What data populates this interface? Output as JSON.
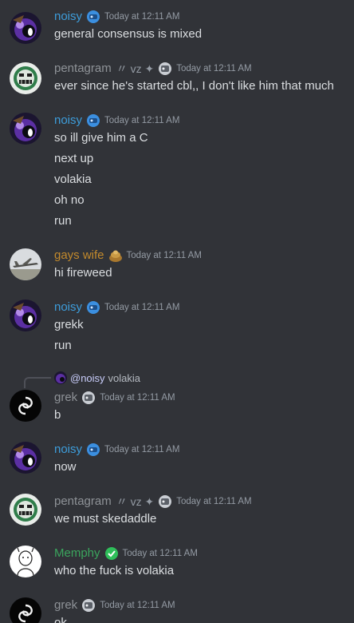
{
  "colors": {
    "background": "#313338",
    "noisy": "#3d9ddb",
    "pentagram": "#8e9297",
    "gays_wife": "#c38a2c",
    "grek": "#8e9297",
    "memphy": "#3ba55d",
    "message_text": "#dbdee1",
    "timestamp": "#949ba4"
  },
  "messages": [
    {
      "author": "noisy",
      "tag": "",
      "role_icon": "blue-emblem-icon",
      "timestamp": "Today at 12:11 AM",
      "lines": [
        "general consensus is mixed"
      ]
    },
    {
      "author": "pentagram",
      "tag": "〃 vz ✦",
      "role_icon": "grey-emblem-icon",
      "timestamp": "Today at 12:11 AM",
      "lines": [
        "ever since he's started cbl,, I don't like him that much"
      ]
    },
    {
      "author": "noisy",
      "tag": "",
      "role_icon": "blue-emblem-icon",
      "timestamp": "Today at 12:11 AM",
      "lines": [
        "so ill give him a C",
        "next up",
        "volakia",
        "oh no",
        "run"
      ]
    },
    {
      "author": "gays wife",
      "tag": "",
      "role_icon": "gold-emblem-icon",
      "timestamp": "Today at 12:11 AM",
      "lines": [
        "hi fireweed"
      ]
    },
    {
      "author": "noisy",
      "tag": "",
      "role_icon": "blue-emblem-icon",
      "timestamp": "Today at 12:11 AM",
      "lines": [
        "grekk",
        "run"
      ]
    },
    {
      "reply": {
        "mention": "@noisy",
        "text": "volakia"
      },
      "author": "grek",
      "tag": "",
      "role_icon": "grey-emblem-icon",
      "timestamp": "Today at 12:11 AM",
      "lines": [
        "b"
      ]
    },
    {
      "author": "noisy",
      "tag": "",
      "role_icon": "blue-emblem-icon",
      "timestamp": "Today at 12:11 AM",
      "lines": [
        "now"
      ]
    },
    {
      "author": "pentagram",
      "tag": "〃 vz ✦",
      "role_icon": "grey-emblem-icon",
      "timestamp": "Today at 12:11 AM",
      "lines": [
        "we must skedaddle"
      ]
    },
    {
      "author": "Memphy",
      "tag": "",
      "role_icon": "green-emblem-icon",
      "timestamp": "Today at 12:11 AM",
      "lines": [
        "who the fuck is volakia"
      ]
    },
    {
      "author": "grek",
      "tag": "",
      "role_icon": "grey-emblem-icon",
      "timestamp": "Today at 12:11 AM",
      "lines": [
        "ok"
      ]
    }
  ]
}
